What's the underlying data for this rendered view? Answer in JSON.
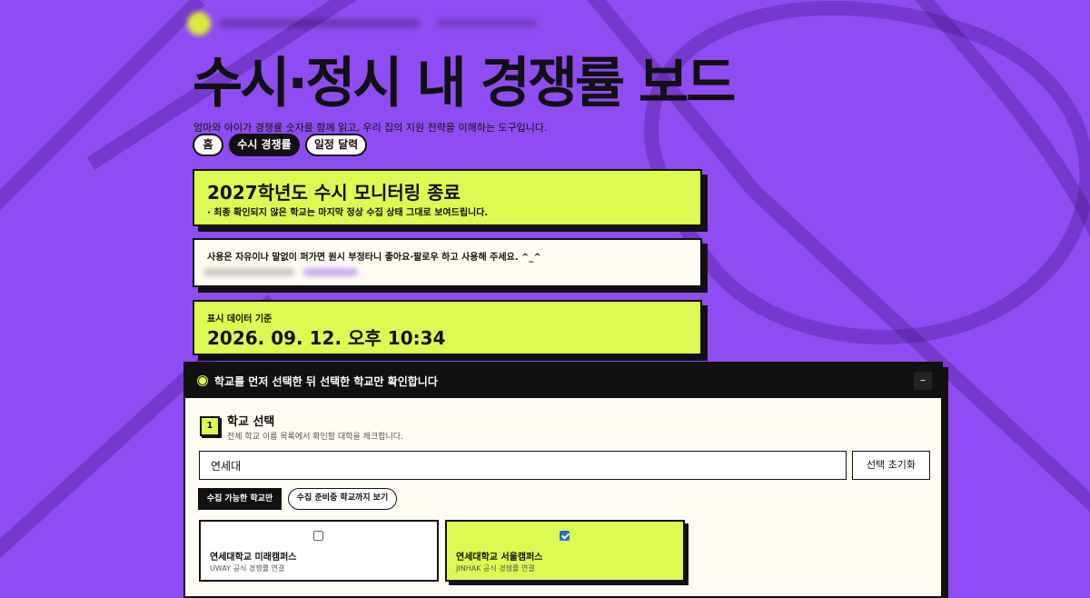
{
  "header": {
    "title": "수시·정시 내 경쟁률 보드",
    "subtitle": "엄마와 아이가 경쟁률 숫자를 함께 읽고, 우리 집의 지원 전략을 이해하는 도구입니다."
  },
  "nav": {
    "items": [
      {
        "label": "홈",
        "active": false
      },
      {
        "label": "수시 경쟁률",
        "active": true
      },
      {
        "label": "일정 달력",
        "active": false
      }
    ]
  },
  "notice": {
    "title": "2027학년도 수시 모니터링 종료",
    "note": "· 최종 확인되지 않은 학교는 마지막 정상 수집 상태 그대로 보여드립니다."
  },
  "usage": {
    "text": "사용은 자유이나 말없이 퍼가면 원시 부정타니 좋아요·팔로우 하고 사용해 주세요. ^_^"
  },
  "data_basis": {
    "label": "표시 데이터 기준",
    "timestamp": "2026. 09. 12. 오후 10:34"
  },
  "panel": {
    "title": "학교를 먼저 선택한 뒤 선택한 학교만 확인합니다",
    "collapse_label": "–",
    "step": {
      "number": "1",
      "title": "학교 선택",
      "description": "전체 학교 이름 목록에서 확인할 대학을 체크합니다."
    },
    "search": {
      "value": "연세대"
    },
    "reset_label": "선택 초기화",
    "filters": [
      {
        "label": "수집 가능한 학교만",
        "active": true
      },
      {
        "label": "수집 준비중 학교까지 보기",
        "active": false
      }
    ],
    "schools": [
      {
        "name": "연세대학교 미래캠퍼스",
        "source": "UWAY 공식 경쟁률 연결",
        "checked": false
      },
      {
        "name": "연세대학교 서울캠퍼스",
        "source": "JINHAK 공식 경쟁률 연결",
        "checked": true
      }
    ]
  },
  "colors": {
    "background": "#8f4cf2",
    "accent_lime": "#dcfa51",
    "ink": "#111111",
    "card_cream": "#fffcf3",
    "checkbox_blue": "#1d6fe0"
  }
}
